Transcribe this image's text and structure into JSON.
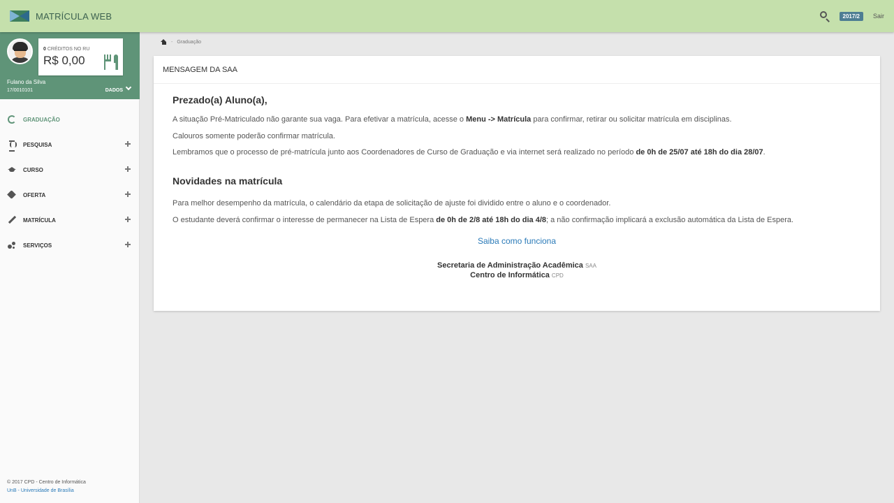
{
  "app": {
    "title": "MATRÍCULA WEB"
  },
  "topbar": {
    "semester": "2017/2",
    "logout_label": "Sair"
  },
  "profile": {
    "credits_count": "0",
    "credits_label": "CRÉDITOS NO RU",
    "balance": "R$ 0,00",
    "name": "Fulano da Silva",
    "id": "17/0010101",
    "dados_label": "DADOS"
  },
  "menu": [
    {
      "label": "GRADUAÇÃO",
      "icon": "graduation-icon"
    },
    {
      "label": "PESQUISA",
      "icon": "hourglass-icon"
    },
    {
      "label": "CURSO",
      "icon": "cap-icon"
    },
    {
      "label": "OFERTA",
      "icon": "tag-icon"
    },
    {
      "label": "MATRÍCULA",
      "icon": "pencil-icon"
    },
    {
      "label": "SERVIÇOS",
      "icon": "services-icon"
    }
  ],
  "footer": {
    "line1": "© 2017 CPD - Centro de Informática",
    "line2": "UnB - Universidade de Brasília"
  },
  "breadcrumb": {
    "sep": "-",
    "current": "Graduação"
  },
  "card": {
    "header": "MENSAGEM DA SAA",
    "greeting": "Prezado(a) Aluno(a),",
    "p1_a": "A situação Pré-Matriculado não garante sua vaga. Para efetivar a matrícula, acesse o ",
    "p1_b": "Menu -> Matrícula",
    "p1_c": " para confirmar, retirar ou solicitar matrícula em disciplinas.",
    "p2": "Calouros somente poderão confirmar matrícula.",
    "p3_a": "Lembramos que o processo de pré-matrícula junto aos Coordenadores de Curso de Graduação e via internet será realizado no período ",
    "p3_b": "de 0h de 25/07 até 18h do dia 28/07",
    "p3_c": ".",
    "news_title": "Novidades na matrícula",
    "p4": "Para melhor desempenho da matrícula, o calendário da etapa de solicitação de ajuste foi dividido entre o aluno e o coordenador.",
    "p5_a": "O estudante deverá confirmar o interesse de permanecer na Lista de Espera ",
    "p5_b": "de 0h de 2/8 até 18h do dia 4/8",
    "p5_c": "; a não confirmação implicará a exclusão automática da Lista de Espera.",
    "link": "Saiba como funciona",
    "sig1": "Secretaria de Administração Acadêmica",
    "sig1_abbr": "SAA",
    "sig2": "Centro de Informática",
    "sig2_abbr": "CPD"
  },
  "colors": {
    "topbar": "#c5e0ac",
    "profile": "#5f9478",
    "link": "#2a7ab8",
    "badge": "#4d7d93"
  }
}
